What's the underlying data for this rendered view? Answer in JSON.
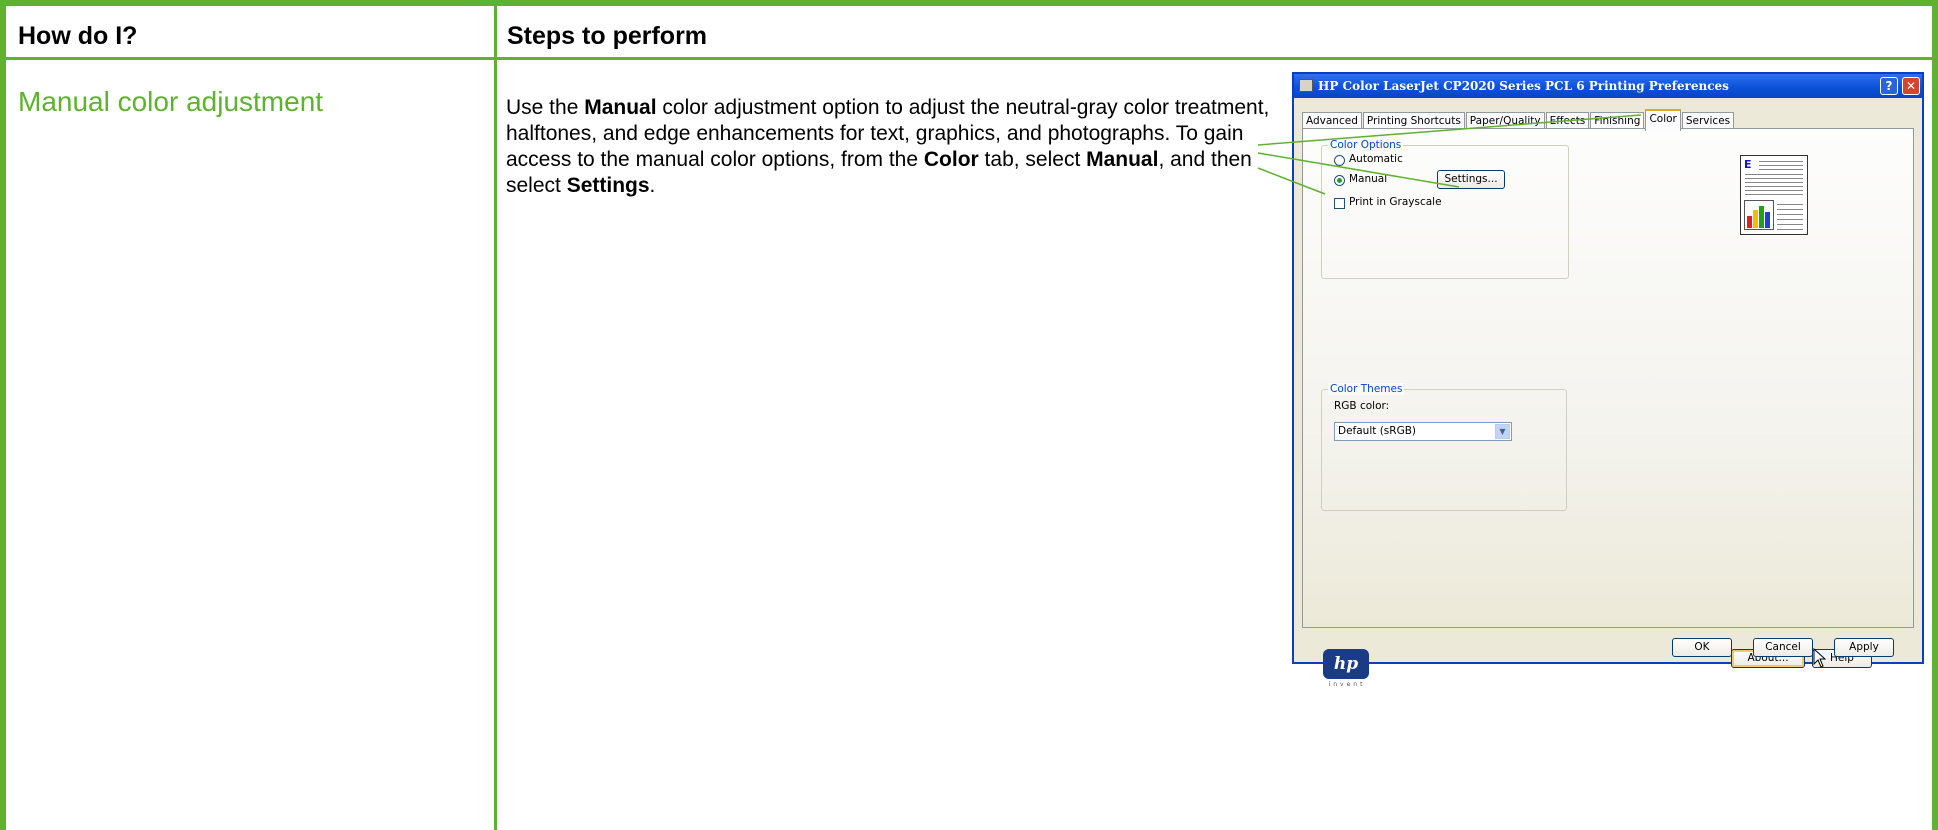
{
  "table": {
    "header_col1": "How do I?",
    "header_col2": "Steps to perform",
    "topic": "Manual color adjustment"
  },
  "steps": {
    "t1": "Use the ",
    "b1": "Manual",
    "t2": " color adjustment option to adjust the neutral-gray color treatment, halftones, and edge enhancements for text, graphics, and photographs. To gain access to the manual color options, from the ",
    "b2": "Color",
    "t3": " tab, select ",
    "b3": "Manual",
    "t4": ", and then select ",
    "b4": "Settings",
    "t5": "."
  },
  "dialog": {
    "title": "HP Color LaserJet CP2020 Series PCL 6 Printing Preferences",
    "help_btn": "?",
    "close_btn": "✕",
    "tabs": [
      "Advanced",
      "Printing Shortcuts",
      "Paper/Quality",
      "Effects",
      "Finishing",
      "Color",
      "Services"
    ],
    "active_tab": "Color",
    "color_options": {
      "label": "Color Options",
      "automatic": "Automatic",
      "manual": "Manual",
      "selected": "Manual",
      "settings_button": "Settings...",
      "grayscale": "Print in Grayscale",
      "grayscale_checked": false
    },
    "color_themes": {
      "label": "Color Themes",
      "rgb_label": "RGB color:",
      "rgb_value": "Default (sRGB)"
    },
    "logo_text": "hp",
    "logo_sub": "invent",
    "buttons": {
      "about": "About...",
      "help": "Help",
      "ok": "OK",
      "cancel": "Cancel",
      "apply": "Apply"
    }
  },
  "colors": {
    "accent_green": "#5eb22f",
    "title_blue": "#0a50d8",
    "group_label_blue": "#0046d5"
  }
}
